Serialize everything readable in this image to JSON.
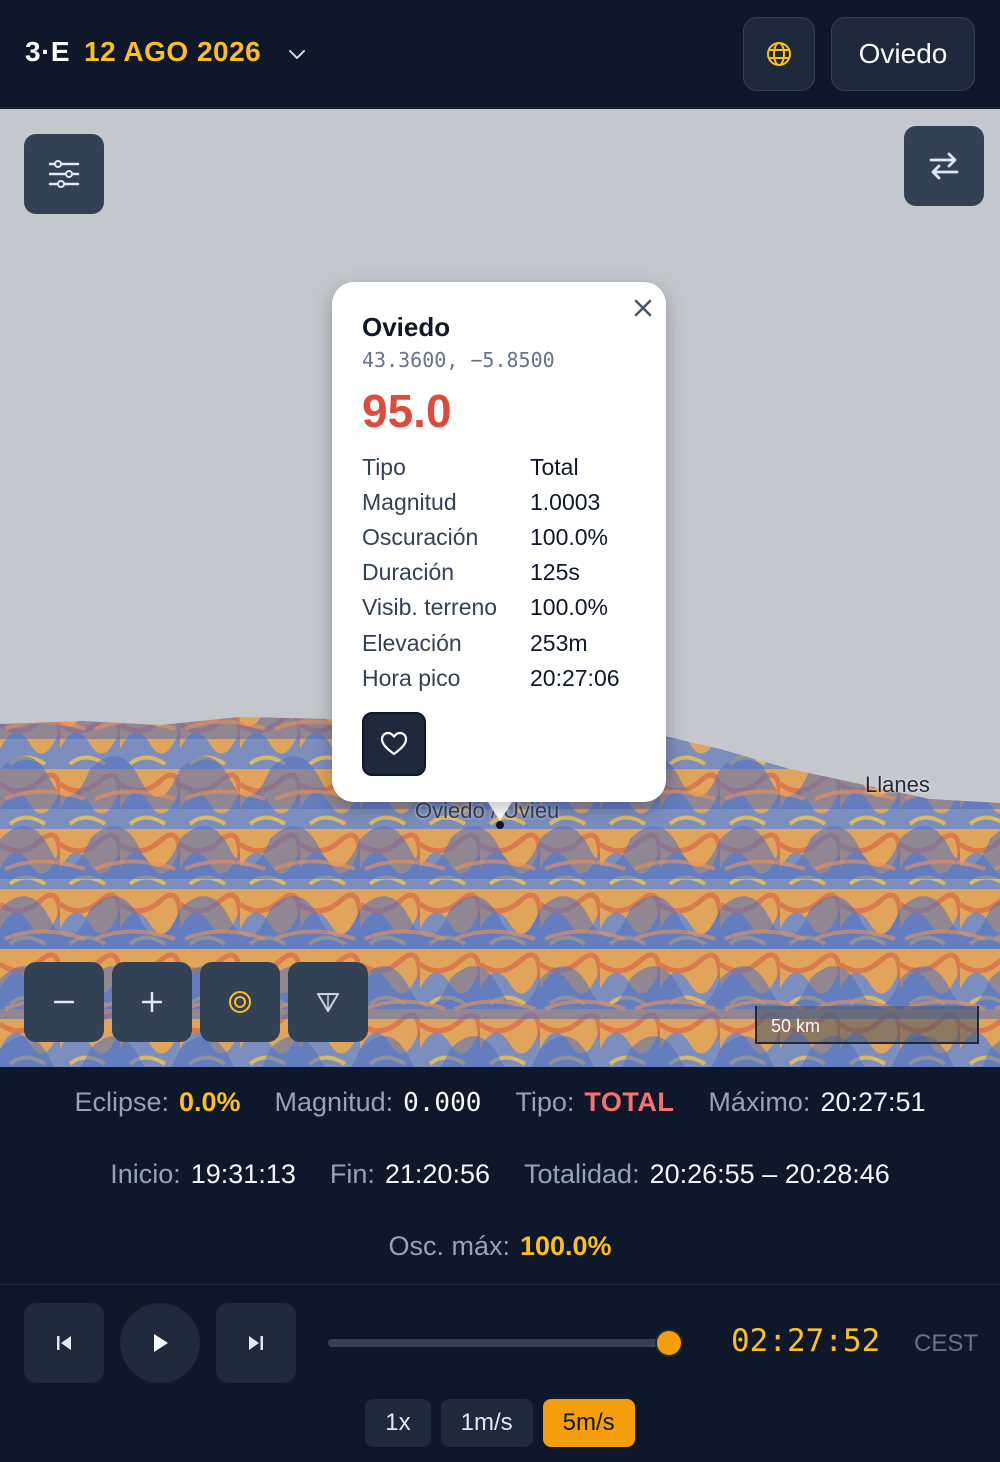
{
  "header": {
    "brand": "3·E",
    "date": "12 AGO 2026",
    "location_button": "Oviedo"
  },
  "map": {
    "labels": {
      "llanes": "Llanes",
      "oviedo": "Oviedo / Uvieu"
    },
    "scale": "50 km",
    "colors": {
      "water": "#c4c8cc",
      "terrain_high": "#e8a04a",
      "terrain_low": "#5b7fc7"
    }
  },
  "popup": {
    "title": "Oviedo",
    "coords": "43.3600, −5.8500",
    "score": "95.0",
    "rows": [
      {
        "k": "Tipo",
        "v": "Total"
      },
      {
        "k": "Magnitud",
        "v": "1.0003"
      },
      {
        "k": "Oscuración",
        "v": "100.0%"
      },
      {
        "k": "Duración",
        "v": "125s"
      },
      {
        "k": "Visib. terreno",
        "v": "100.0%"
      },
      {
        "k": "Elevación",
        "v": "253m"
      },
      {
        "k": "Hora pico",
        "v": "20:27:06"
      }
    ]
  },
  "stats": {
    "eclipse": {
      "k": "Eclipse:",
      "v": "0.0%"
    },
    "magnitude": {
      "k": "Magnitud:",
      "v": "0.000"
    },
    "type": {
      "k": "Tipo:",
      "v": "TOTAL"
    },
    "maximum": {
      "k": "Máximo:",
      "v": "20:27:51"
    },
    "start": {
      "k": "Inicio:",
      "v": "19:31:13"
    },
    "end": {
      "k": "Fin:",
      "v": "21:20:56"
    },
    "totality": {
      "k": "Totalidad:",
      "v": "20:26:55 – 20:28:46"
    },
    "max_obscuration": {
      "k": "Osc. máx:",
      "v": "100.0%"
    }
  },
  "player": {
    "progress": 0.99,
    "time": "02:27:52",
    "timezone": "CEST",
    "speeds": [
      "1x",
      "1m/s",
      "5m/s"
    ],
    "active_speed": "5m/s",
    "accent": "#f59e0b"
  }
}
